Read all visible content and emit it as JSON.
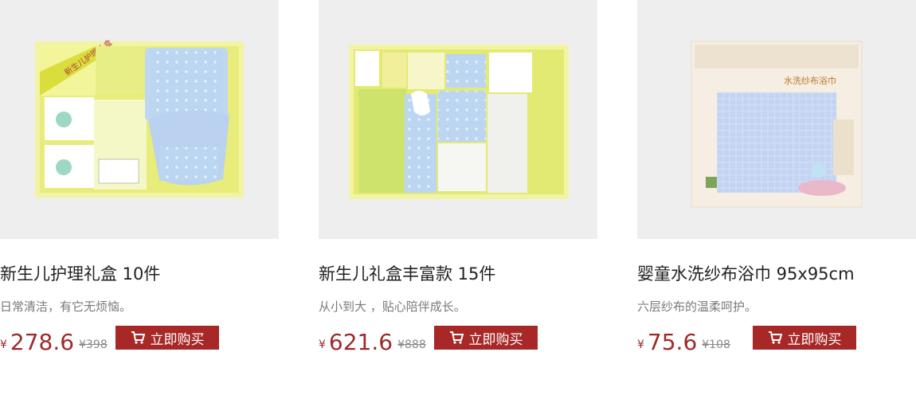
{
  "products": [
    {
      "image_alt": "新生儿护理礼盒",
      "box_label": "新生儿护理礼盒",
      "title": "新生儿护理礼盒 10件",
      "desc": "日常清洁，有它无烦恼。",
      "currency": "¥",
      "price": "278.6",
      "old_price": "¥398",
      "buy_label": "立即购买"
    },
    {
      "image_alt": "新生儿礼盒丰富款",
      "title": "新生儿礼盒丰富款 15件",
      "desc": "从小到大 ，贴心陪伴成长。",
      "currency": "¥",
      "price": "621.6",
      "old_price": "¥888",
      "buy_label": "立即购买"
    },
    {
      "image_alt": "婴童水洗纱布浴巾",
      "box_label": "水洗纱布浴巾",
      "title": "婴童水洗纱布浴巾 95x95cm",
      "desc": "六层纱布的温柔呵护。",
      "currency": "¥",
      "price": "75.6",
      "old_price": "¥108",
      "buy_label": "立即购买"
    }
  ],
  "colors": {
    "accent": "#a82727",
    "price": "#9d2a2a",
    "thumb_bg": "#eeeeef",
    "box_yellow": "#eef28a"
  },
  "icons": {
    "buy": "cart-icon"
  }
}
